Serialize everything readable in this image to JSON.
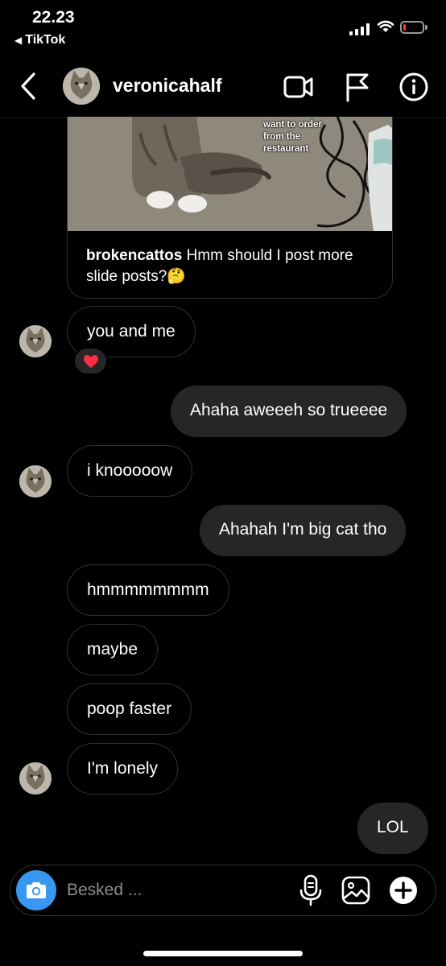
{
  "status": {
    "time": "22.23",
    "back_app": "TikTok",
    "battery_level": 0.12,
    "battery_color": "#ff3b30"
  },
  "header": {
    "username": "veronicahalf"
  },
  "shared_post": {
    "meme_text_lines": [
      "want to order",
      "from the",
      "restaurant"
    ],
    "author": "brokencattos",
    "caption": "Hmm should I post more slide posts?",
    "caption_emoji": "🤔"
  },
  "messages": [
    {
      "from": "them",
      "text": "you and me",
      "reaction": "❤️",
      "show_avatar": true
    },
    {
      "from": "me",
      "text": "Ahaha aweeeh so trueeee"
    },
    {
      "from": "them",
      "text": "i knooooow",
      "show_avatar": true
    },
    {
      "from": "me",
      "text": "Ahahah I'm big cat tho"
    },
    {
      "from": "them",
      "text": "hmmmmmmmm",
      "show_avatar": false
    },
    {
      "from": "them",
      "text": "maybe",
      "show_avatar": false
    },
    {
      "from": "them",
      "text": "poop faster",
      "show_avatar": false
    },
    {
      "from": "them",
      "text": "I'm lonely",
      "show_avatar": true
    },
    {
      "from": "me",
      "text": "LOL"
    }
  ],
  "composer": {
    "placeholder": "Besked ..."
  },
  "colors": {
    "background": "#000000",
    "outgoing_bubble": "#262626",
    "incoming_border": "#303030",
    "camera_button": "#3897f0"
  },
  "icons": {
    "back": "chevron-left-icon",
    "video": "video-camera-icon",
    "flag": "flag-icon",
    "info": "info-icon",
    "camera": "camera-icon",
    "mic": "microphone-icon",
    "gallery": "image-icon",
    "add": "plus-circle-icon"
  }
}
